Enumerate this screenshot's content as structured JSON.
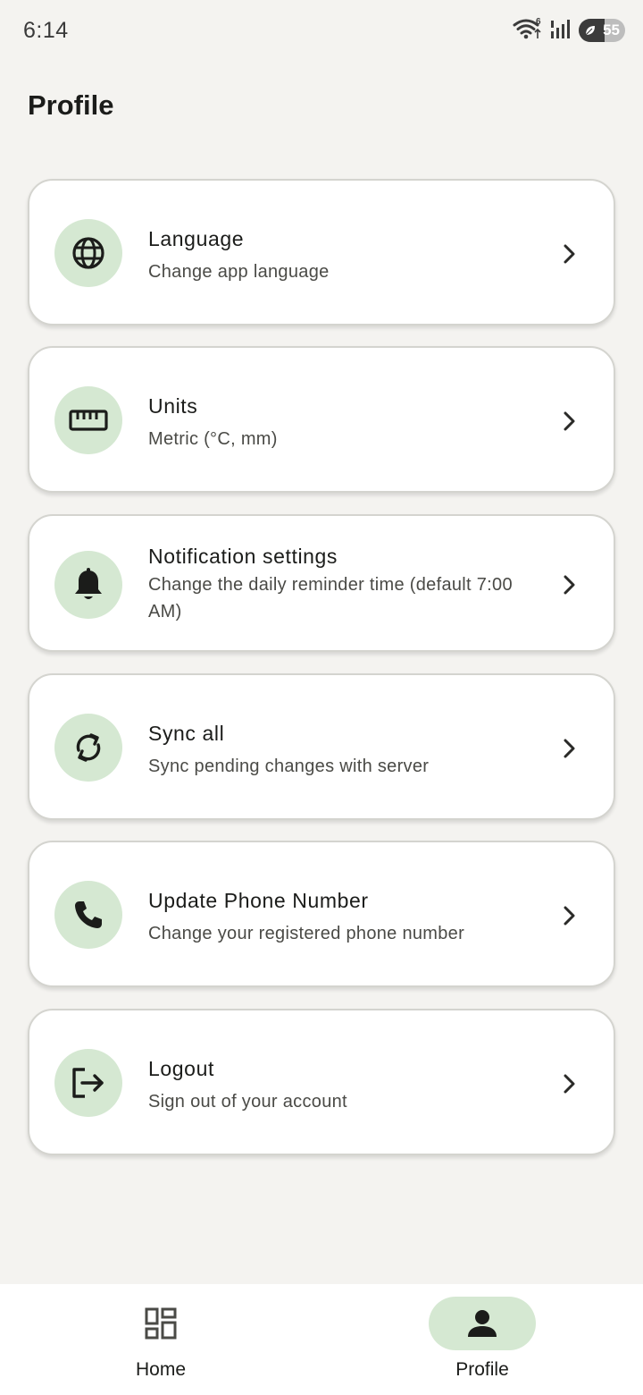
{
  "status_bar": {
    "time": "6:14",
    "battery_level": "55",
    "wifi_badge": "6"
  },
  "page": {
    "title": "Profile"
  },
  "settings": [
    {
      "title": "Language",
      "subtitle": "Change app language",
      "icon": "globe-icon"
    },
    {
      "title": "Units",
      "subtitle": "Metric (°C, mm)",
      "icon": "ruler-icon"
    },
    {
      "title": "Notification settings",
      "subtitle": "Change the daily reminder time (default 7:00 AM)",
      "icon": "bell-icon"
    },
    {
      "title": "Sync all",
      "subtitle": "Sync pending changes with server",
      "icon": "sync-icon"
    },
    {
      "title": "Update Phone Number",
      "subtitle": "Change your registered phone number",
      "icon": "phone-icon"
    },
    {
      "title": "Logout",
      "subtitle": "Sign out of your account",
      "icon": "logout-icon"
    }
  ],
  "bottom_nav": {
    "items": [
      {
        "label": "Home",
        "icon": "dashboard-icon",
        "active": false
      },
      {
        "label": "Profile",
        "icon": "person-icon",
        "active": true
      }
    ]
  },
  "colors": {
    "background": "#f4f3f0",
    "icon_circle": "#d5e8d2",
    "active_pill": "#d5e8d2",
    "card": "#ffffff",
    "text_primary": "#1b1c1a"
  }
}
